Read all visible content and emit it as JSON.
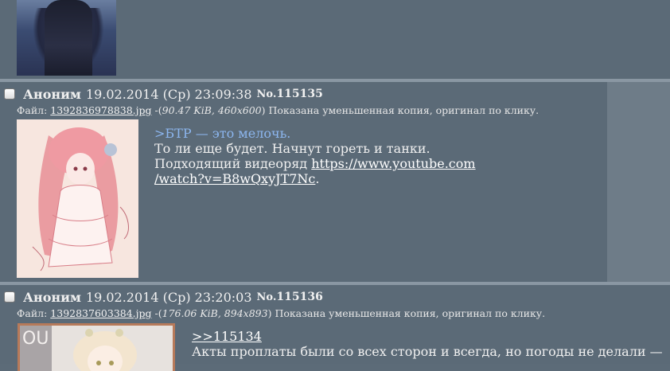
{
  "posts": [
    {
      "checkbox_checked": false,
      "name": "Аноним",
      "datetime": "19.02.2014 (Ср) 23:09:38",
      "no_prefix": "No.",
      "no": "115135",
      "file_label": "Файл:",
      "filename": "1392836978838.jpg",
      "file_meta_prefix": " -(",
      "file_meta": "90.47 KiB, 460x600",
      "file_meta_suffix": ")",
      "file_note": " Показана уменьшенная копия, оригинал по клику.",
      "greentext": ">БТР — это мелочь.",
      "line2": "То ли еще будет. Начнут гореть и танки.",
      "line3_text": "Подходящий видеоряд ",
      "link1": "https://www.youtube.com",
      "link2": "/watch?v=B8wQxyJT7Nc",
      "link_end": "."
    },
    {
      "checkbox_checked": false,
      "name": "Аноним",
      "datetime": "19.02.2014 (Ср) 23:20:03",
      "no_prefix": "No.",
      "no": "115136",
      "file_label": "Файл:",
      "filename": "1392837603384.jpg",
      "file_meta_prefix": " -(",
      "file_meta": "176.06 KiB, 894x893",
      "file_meta_suffix": ")",
      "file_note": " Показана уменьшенная копия, оригинал по клику.",
      "reply_ref": ">>115134",
      "line2": "Акты проплаты были со всех сторон и всегда, но погоды не делали —"
    }
  ]
}
